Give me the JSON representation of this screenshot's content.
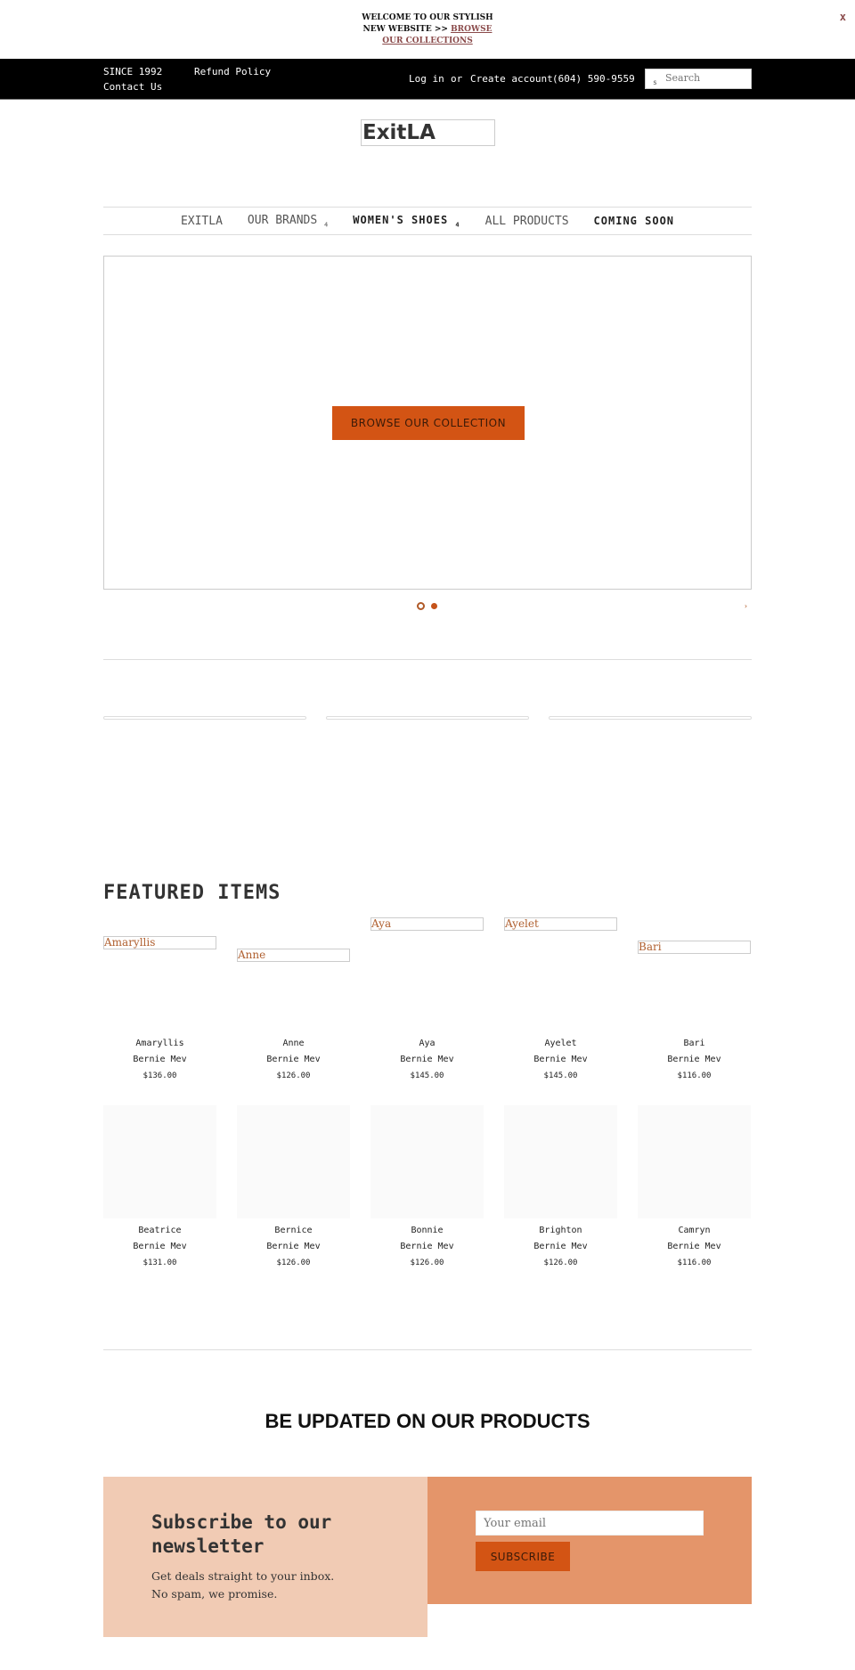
{
  "announcement": {
    "text": "WELCOME TO OUR STYLISH NEW WEBSITE >> ",
    "link": "BROWSE OUR COLLECTIONS",
    "close": "x"
  },
  "topbar": {
    "since": "SINCE 1992",
    "refund": "Refund Policy",
    "contact": "Contact Us",
    "login": "Log in",
    "or": "or",
    "create": "Create account",
    "phone": "(604) 590-9559",
    "search_icon": "s",
    "search_placeholder": "Search"
  },
  "logo": "ExitLA",
  "nav": [
    {
      "label": "EXITLA"
    },
    {
      "label": "OUR BRANDS",
      "arrow": "4"
    },
    {
      "label": "WOMEN'S SHOES",
      "arrow": "4"
    },
    {
      "label": "ALL PRODUCTS"
    },
    {
      "label": "COMING SOON"
    }
  ],
  "hero": {
    "button": "BROWSE OUR COLLECTION",
    "next_arrow": "›",
    "accent": "#d35414"
  },
  "featured": {
    "title": "FEATURED ITEMS",
    "products": [
      {
        "name": "Amaryllis",
        "brand": "Bernie Mev",
        "price": "$136.00"
      },
      {
        "name": "Anne",
        "brand": "Bernie Mev",
        "price": "$126.00"
      },
      {
        "name": "Aya",
        "brand": "Bernie Mev",
        "price": "$145.00"
      },
      {
        "name": "Ayelet",
        "brand": "Bernie Mev",
        "price": "$145.00"
      },
      {
        "name": "Bari",
        "brand": "Bernie Mev",
        "price": "$116.00"
      },
      {
        "name": "Beatrice",
        "brand": "Bernie Mev",
        "price": "$131.00"
      },
      {
        "name": "Bernice",
        "brand": "Bernie Mev",
        "price": "$126.00"
      },
      {
        "name": "Bonnie",
        "brand": "Bernie Mev",
        "price": "$126.00"
      },
      {
        "name": "Brighton",
        "brand": "Bernie Mev",
        "price": "$126.00"
      },
      {
        "name": "Camryn",
        "brand": "Bernie Mev",
        "price": "$116.00"
      }
    ]
  },
  "updates": {
    "title": "BE UPDATED ON OUR PRODUCTS"
  },
  "newsletter": {
    "title": "Subscribe to our newsletter",
    "text1": "Get deals straight to your inbox.",
    "text2": "No spam, we promise.",
    "email_placeholder": "Your email",
    "button": "SUBSCRIBE"
  }
}
